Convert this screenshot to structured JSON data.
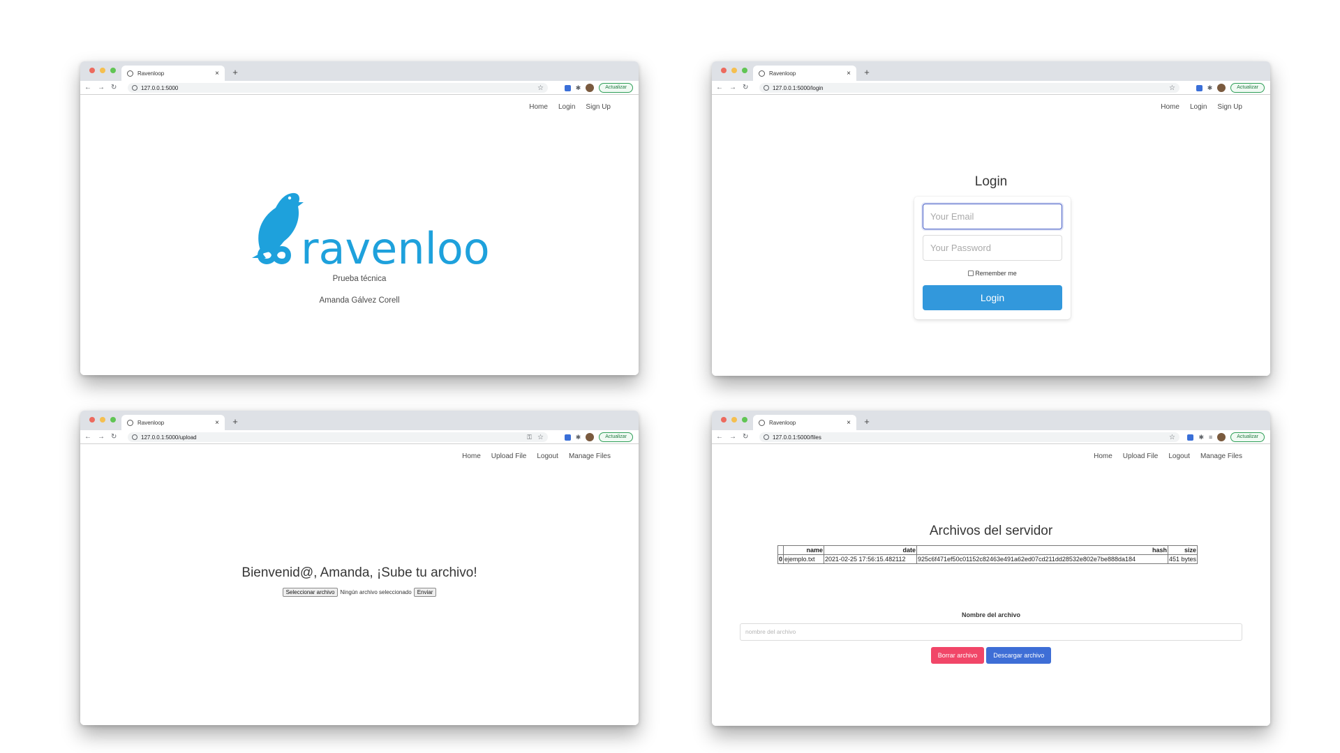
{
  "browser": {
    "tab_title": "Ravenloop",
    "update_label": "Actualizar"
  },
  "windows": [
    {
      "url": "127.0.0.1:5000",
      "nav": [
        "Home",
        "Login",
        "Sign Up"
      ],
      "logo_text": "ravenloop",
      "subtitle": "Prueba técnica",
      "author": "Amanda Gálvez Corell"
    },
    {
      "url": "127.0.0.1:5000/login",
      "nav": [
        "Home",
        "Login",
        "Sign Up"
      ],
      "title": "Login",
      "email_placeholder": "Your Email",
      "password_placeholder": "Your Password",
      "remember_label": "Remember me",
      "login_button": "Login"
    },
    {
      "url": "127.0.0.1:5000/upload",
      "nav": [
        "Home",
        "Upload File",
        "Logout",
        "Manage Files"
      ],
      "welcome": "Bienvenid@, Amanda, ¡Sube tu archivo!",
      "choose_file": "Seleccionar archivo",
      "no_file": "Ningún archivo seleccionado",
      "submit": "Enviar"
    },
    {
      "url": "127.0.0.1:5000/files",
      "nav": [
        "Home",
        "Upload File",
        "Logout",
        "Manage Files"
      ],
      "title": "Archivos del servidor",
      "table": {
        "columns": [
          "",
          "name",
          "date",
          "hash",
          "size"
        ],
        "rows": [
          [
            "0",
            "ejemplo.txt",
            "2021-02-25 17:56:15.482112",
            "925c6f471ef50c01152c82463e491a62ed07cd211dd28532e802e7be888da184",
            "451 bytes"
          ]
        ]
      },
      "filename_label": "Nombre del archivo",
      "filename_placeholder": "nombre del archivo",
      "delete_button": "Borrar archivo",
      "download_button": "Descargar archivo"
    }
  ],
  "colors": {
    "brand": "#1ea1dc",
    "login_button": "#3298dc",
    "delete_button": "#f14668",
    "download_button": "#3e6ed6"
  }
}
